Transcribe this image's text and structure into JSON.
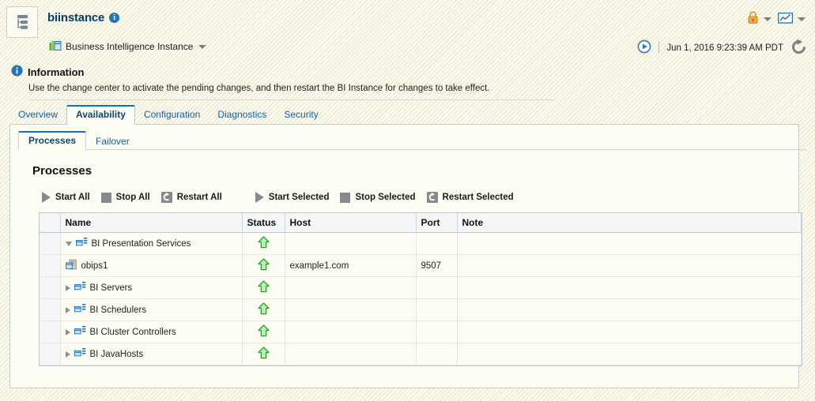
{
  "header": {
    "app_icon": "tree-list-icon",
    "title": "biinstance",
    "info_icon": "i",
    "subtitle": "Business Intelligence Instance",
    "subtitle_icon": "bi-instance-icon",
    "dropdown_icon": "chevron-down-icon",
    "lock_icon": "lock-icon",
    "chart_icon": "chart-icon",
    "play_icon": "play-circle-icon",
    "timestamp": "Jun 1, 2016 9:23:39 AM PDT",
    "refresh_icon": "refresh-icon"
  },
  "information": {
    "icon": "info-icon",
    "heading": "Information",
    "message": "Use the change center to activate the pending changes, and then restart the BI Instance for changes to take effect."
  },
  "main_tabs": [
    {
      "label": "Overview",
      "active": false
    },
    {
      "label": "Availability",
      "active": true
    },
    {
      "label": "Configuration",
      "active": false
    },
    {
      "label": "Diagnostics",
      "active": false
    },
    {
      "label": "Security",
      "active": false
    }
  ],
  "sub_tabs": [
    {
      "label": "Processes",
      "active": true
    },
    {
      "label": "Failover",
      "active": false
    }
  ],
  "section": {
    "title": "Processes"
  },
  "toolbar": [
    {
      "label": "Start All",
      "icon": "play-icon"
    },
    {
      "label": "Stop All",
      "icon": "stop-icon"
    },
    {
      "label": "Restart All",
      "icon": "restart-icon"
    },
    {
      "label": "Start Selected",
      "icon": "play-icon"
    },
    {
      "label": "Stop Selected",
      "icon": "stop-icon"
    },
    {
      "label": "Restart Selected",
      "icon": "restart-icon"
    }
  ],
  "table": {
    "columns": [
      "",
      "Name",
      "Status",
      "Host",
      "Port",
      "Note"
    ],
    "rows": [
      {
        "name": "BI Presentation Services",
        "indent": 0,
        "twisty": "expanded",
        "icon": "process-group-icon",
        "status": "up",
        "host": "",
        "port": "",
        "note": ""
      },
      {
        "name": "obips1",
        "indent": 1,
        "twisty": "none",
        "icon": "process-node-icon",
        "status": "up",
        "host": "example1.com",
        "port": "9507",
        "note": ""
      },
      {
        "name": "BI Servers",
        "indent": 0,
        "twisty": "collapsed",
        "icon": "process-group-icon",
        "status": "up",
        "host": "",
        "port": "",
        "note": ""
      },
      {
        "name": "BI Schedulers",
        "indent": 0,
        "twisty": "collapsed",
        "icon": "process-group-icon",
        "status": "up",
        "host": "",
        "port": "",
        "note": ""
      },
      {
        "name": "BI Cluster Controllers",
        "indent": 0,
        "twisty": "collapsed",
        "icon": "process-group-icon",
        "status": "up",
        "host": "",
        "port": "",
        "note": ""
      },
      {
        "name": "BI JavaHosts",
        "indent": 0,
        "twisty": "collapsed",
        "icon": "process-group-icon",
        "status": "up",
        "host": "",
        "port": "",
        "note": ""
      }
    ]
  },
  "colors": {
    "accent_blue": "#1560a8",
    "tab_active_border": "#0f72c4",
    "status_up_green": "#3fae3f",
    "page_bg": "#fbfbef",
    "toolbar_icon_gray": "#858a8f"
  }
}
